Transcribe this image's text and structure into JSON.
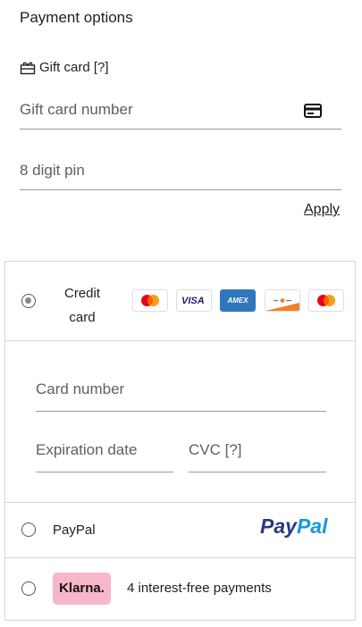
{
  "title": "Payment options",
  "gift_card": {
    "heading": "Gift card [?]",
    "number_placeholder": "Gift card number",
    "pin_placeholder": "8 digit pin",
    "apply_label": "Apply"
  },
  "credit_card": {
    "label_line1": "Credit",
    "label_line2": "card",
    "selected": true,
    "logos": [
      {
        "name": "mastercard",
        "icon": "mastercard-icon"
      },
      {
        "name": "visa",
        "text": "VISA",
        "icon": "visa-icon"
      },
      {
        "name": "amex",
        "text": "AMEX",
        "icon": "amex-icon"
      },
      {
        "name": "discover",
        "icon": "discover-icon"
      },
      {
        "name": "maestro",
        "icon": "maestro-icon"
      }
    ],
    "card_number_placeholder": "Card number",
    "expiration_placeholder": "Expiration date",
    "cvc_placeholder": "CVC [?]"
  },
  "paypal": {
    "label": "PayPal",
    "logo_text_1": "Pay",
    "logo_text_2": "Pal",
    "colors": {
      "dark": "#253b80",
      "light": "#179bd7"
    }
  },
  "klarna": {
    "badge": "Klarna.",
    "text": "4 interest-free payments",
    "badge_color": "#f7b6c9"
  }
}
